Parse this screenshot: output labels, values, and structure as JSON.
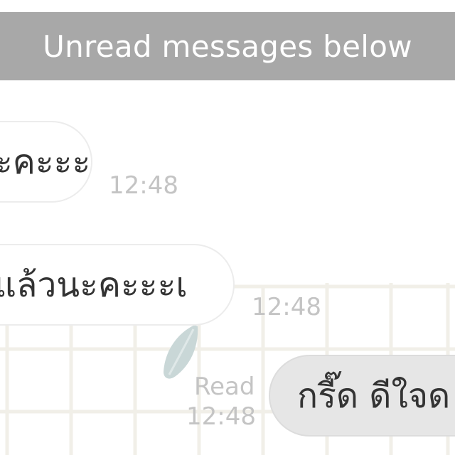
{
  "banner": {
    "text": "Unread messages below"
  },
  "messages": [
    {
      "direction": "incoming",
      "text": "ะคะะะ",
      "time": "12:48"
    },
    {
      "direction": "incoming",
      "text": "แล้วนะคะะะเ",
      "time": "12:48"
    },
    {
      "direction": "outgoing",
      "text": "กรี๊ด ดีใจด",
      "status": "Read",
      "time": "12:48"
    }
  ],
  "colors": {
    "banner_bg": "#a8a8a8",
    "banner_text": "#ffffff",
    "incoming_bubble": "#ffffff",
    "outgoing_bubble": "#e6e6e6",
    "meta_text": "#c4c4c4",
    "grid_line": "#f1efe8",
    "leaf": "#c9d7d7"
  },
  "decorations": {
    "wallpaper": "grid-pattern",
    "sticker_icon": "leaf-icon"
  }
}
